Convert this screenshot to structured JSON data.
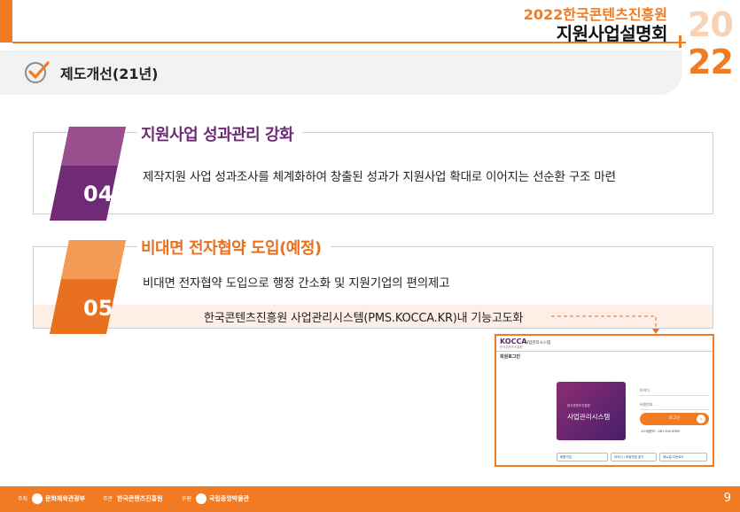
{
  "header": {
    "org": "2022한국콘텐츠진흥원",
    "title": "지원사업설명회",
    "year_top": "20",
    "year_bottom": "22"
  },
  "section": {
    "title": "제도개선(21년)"
  },
  "items": [
    {
      "number": "04",
      "title": "지원사업 성과관리 강화",
      "description": "제작지원 사업 성과조사를 체계화하여 창출된 성과가 지원사업 확대로 이어지는 선순환 구조 마련"
    },
    {
      "number": "05",
      "title": "비대면 전자협약 도입(예정)",
      "description": "비대면 전자협약 도입으로 행정 간소화 및 지원기업의 편의제고",
      "note": "한국콘텐츠진흥원 사업관리시스템(PMS.KOCCA.KR)내 기능고도화"
    }
  ],
  "screenshot": {
    "logo": "KOCCA",
    "logo_sub": "한국콘텐츠진흥원",
    "system_name": "사업관리시스템",
    "login_label": "회원로그인",
    "card_sub": "한국콘텐츠진흥원",
    "card_title": "사업관리시스템",
    "id_placeholder": "아이디",
    "pw_placeholder": "비밀번호",
    "login_button": "로그인",
    "contact": "시스템문의 : 061 900 6369",
    "links": [
      "회원가입",
      "아이디 / 비밀번호 찾기",
      "매뉴얼 다운로드"
    ]
  },
  "footer": {
    "label1": "주최",
    "org1": "문화체육관광부",
    "label2": "주관",
    "org2": "한국콘텐츠진흥원",
    "label3": "후원",
    "org3": "국립중앙박물관",
    "page_number": "9"
  },
  "colors": {
    "accent": "#f07b22",
    "purple": "#6f2b76"
  }
}
